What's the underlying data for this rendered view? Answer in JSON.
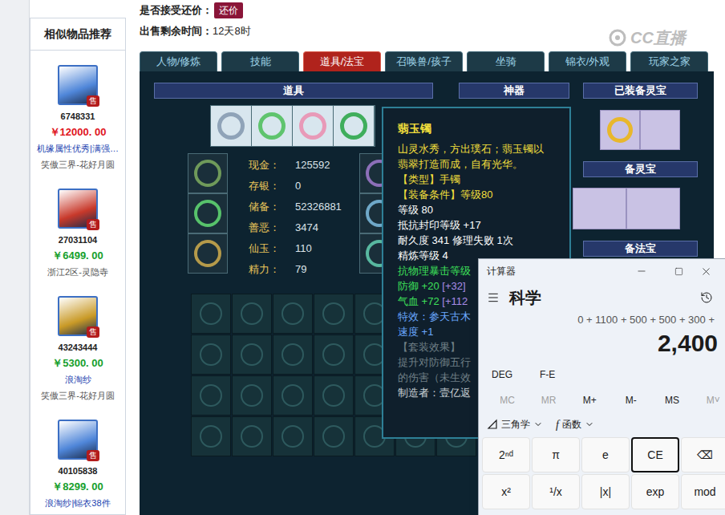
{
  "watermark": "CC直播",
  "offer": {
    "label": "是否接受还价：",
    "button": "还价"
  },
  "remaining": {
    "label": "出售剩余时间：",
    "value": "12天8时"
  },
  "sidebar": {
    "title": "相似物品推荐",
    "items": [
      {
        "id": "6748331",
        "price": "￥12000. 00",
        "price_color": "#e0141e",
        "tags": "机缘属性优秀|满强…",
        "server": "笑傲三界-花好月圆",
        "badge": "售",
        "color": "#4f86d9"
      },
      {
        "id": "27031104",
        "price": "￥6499. 00",
        "price_color": "#16a02c",
        "server": "浙江2区-灵隐寺",
        "badge": "售",
        "color": "#c8392b"
      },
      {
        "id": "43243444",
        "price": "￥5300. 00",
        "price_color": "#16a02c",
        "tags": "浪淘纱",
        "server": "笑傲三界-花好月圆",
        "badge": "售",
        "color": "#c99a27"
      },
      {
        "id": "40105838",
        "price": "￥8299. 00",
        "price_color": "#16a02c",
        "tags": "浪淘纱|锦衣38件",
        "badge": "售",
        "color": "#4f86d9"
      }
    ]
  },
  "tabs": [
    {
      "label": "人物/修炼",
      "selected": false
    },
    {
      "label": "技能",
      "selected": false
    },
    {
      "label": "道具/法宝",
      "selected": true
    },
    {
      "label": "召唤兽/孩子",
      "selected": false
    },
    {
      "label": "坐骑",
      "selected": false
    },
    {
      "label": "锦衣/外观",
      "selected": false
    },
    {
      "label": "玩家之家",
      "selected": false
    }
  ],
  "panel": {
    "items_header": "道具",
    "artifact_header": "神器",
    "equipped_lingbao_header": "已装备灵宝",
    "spare_lingbao_header": "备灵宝",
    "spare_fabao_header": "备法宝",
    "stats": [
      {
        "label": "现金：",
        "value": "125592"
      },
      {
        "label": "存银：",
        "value": "0"
      },
      {
        "label": "储备：",
        "value": "52326881"
      },
      {
        "label": "善恶：",
        "value": "3474"
      },
      {
        "label": "仙玉：",
        "value": "110"
      },
      {
        "label": "精力：",
        "value": "79"
      }
    ]
  },
  "tooltip": {
    "title": "翡玉镯",
    "lines": [
      {
        "parts": [
          {
            "text": "山灵水秀，方出璞石；翡玉镯以翡翠打造而成，自有光华。",
            "color": "#f2df3c"
          }
        ]
      },
      {
        "parts": [
          {
            "text": "【类型】手镯",
            "color": "#f2df3c"
          }
        ]
      },
      {
        "parts": [
          {
            "text": "【装备条件】等级80",
            "color": "#f2df3c"
          }
        ]
      },
      {
        "parts": [
          {
            "text": "等级 80",
            "color": "#ffffff"
          }
        ]
      },
      {
        "parts": [
          {
            "text": "抵抗封印等级 +17",
            "color": "#ffffff"
          }
        ]
      },
      {
        "parts": [
          {
            "text": "耐久度 341 修理失败 1次",
            "color": "#ffffff"
          }
        ]
      },
      {
        "parts": [
          {
            "text": "精炼等级 4",
            "color": "#ffffff"
          }
        ]
      },
      {
        "parts": [
          {
            "text": "抗物理暴击等级",
            "color": "#3ee05a"
          }
        ]
      },
      {
        "parts": [
          {
            "text": "防御 +20 ",
            "color": "#3ee05a"
          },
          {
            "text": "[+32]",
            "color": "#a98de8"
          }
        ]
      },
      {
        "parts": [
          {
            "text": "气血 +72 ",
            "color": "#3ee05a"
          },
          {
            "text": "[+112",
            "color": "#a98de8"
          }
        ]
      },
      {
        "parts": [
          {
            "text": "特效：参天古木",
            "color": "#6aa8ff"
          }
        ]
      },
      {
        "parts": [
          {
            "text": "速度 +1",
            "color": "#6aa8ff"
          }
        ]
      },
      {
        "parts": [
          {
            "text": "【套装效果】",
            "color": "#6f7f86"
          }
        ]
      },
      {
        "parts": [
          {
            "text": "提升对防御五行",
            "color": "#6f7f86"
          }
        ]
      },
      {
        "parts": [
          {
            "text": "的伤害（未生效",
            "color": "#6f7f86"
          }
        ]
      },
      {
        "parts": [
          {
            "text": "制造者：壹亿返",
            "color": "#c8d0d4"
          }
        ]
      }
    ]
  },
  "calculator": {
    "title": "计算器",
    "mode": "科学",
    "expression": "0 + 1100 + 500 + 500 + 300 +",
    "result": "2,400",
    "toggles": [
      "DEG",
      "F-E"
    ],
    "memory": [
      {
        "label": "MC",
        "disabled": true
      },
      {
        "label": "MR",
        "disabled": true
      },
      {
        "label": "M+",
        "disabled": false
      },
      {
        "label": "M-",
        "disabled": false
      },
      {
        "label": "MS",
        "disabled": false
      },
      {
        "label": "M˅",
        "disabled": true
      }
    ],
    "dropdowns": [
      {
        "label": "三角学"
      },
      {
        "label": "函数",
        "symbol": "f"
      }
    ],
    "keys": [
      {
        "label": "2ⁿᵈ",
        "focused": false
      },
      {
        "label": "π",
        "focused": false
      },
      {
        "label": "e",
        "focused": false
      },
      {
        "label": "CE",
        "focused": true
      },
      {
        "label": "⌫",
        "focused": false
      },
      {
        "label": "x²",
        "focused": false
      },
      {
        "label": "¹/x",
        "focused": false
      },
      {
        "label": "|x|",
        "focused": false
      },
      {
        "label": "exp",
        "focused": false
      },
      {
        "label": "mod",
        "focused": false
      }
    ]
  }
}
